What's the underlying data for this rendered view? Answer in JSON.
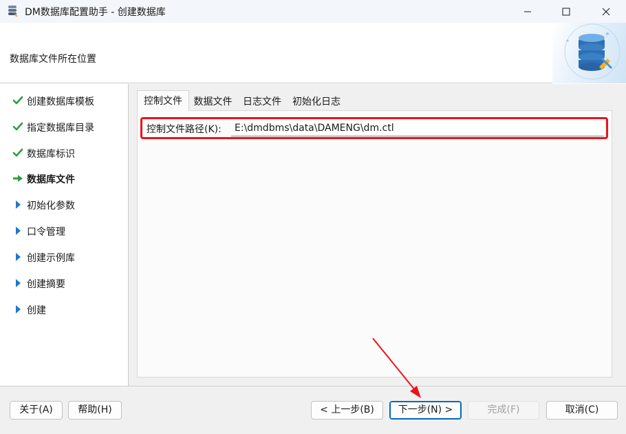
{
  "window": {
    "title": "DM数据库配置助手 - 创建数据库"
  },
  "header": {
    "title": "数据库文件所在位置"
  },
  "sidebar": {
    "steps": [
      {
        "label": "创建数据库模板",
        "state": "done"
      },
      {
        "label": "指定数据库目录",
        "state": "done"
      },
      {
        "label": "数据库标识",
        "state": "done"
      },
      {
        "label": "数据库文件",
        "state": "current"
      },
      {
        "label": "初始化参数",
        "state": "pending"
      },
      {
        "label": "口令管理",
        "state": "pending"
      },
      {
        "label": "创建示例库",
        "state": "pending"
      },
      {
        "label": "创建摘要",
        "state": "pending"
      },
      {
        "label": "创建",
        "state": "pending"
      }
    ]
  },
  "tabs": [
    {
      "label": "控制文件",
      "selected": true
    },
    {
      "label": "数据文件",
      "selected": false
    },
    {
      "label": "日志文件",
      "selected": false
    },
    {
      "label": "初始化日志",
      "selected": false
    }
  ],
  "control_file": {
    "label": "控制文件路径(K):",
    "value": "E:\\dmdbms\\data\\DAMENG\\dm.ctl"
  },
  "footer": {
    "about": "关于(A)",
    "help": "帮助(H)",
    "prev": "< 上一步(B)",
    "next": "下一步(N) >",
    "finish": "完成(F)",
    "cancel": "取消(C)"
  },
  "colors": {
    "done_check": "#2e9e3e",
    "current_arrow": "#2e9e3e",
    "pending_triangle": "#1f78c8",
    "highlight": "#e8141b",
    "accent": "#0067c0"
  }
}
